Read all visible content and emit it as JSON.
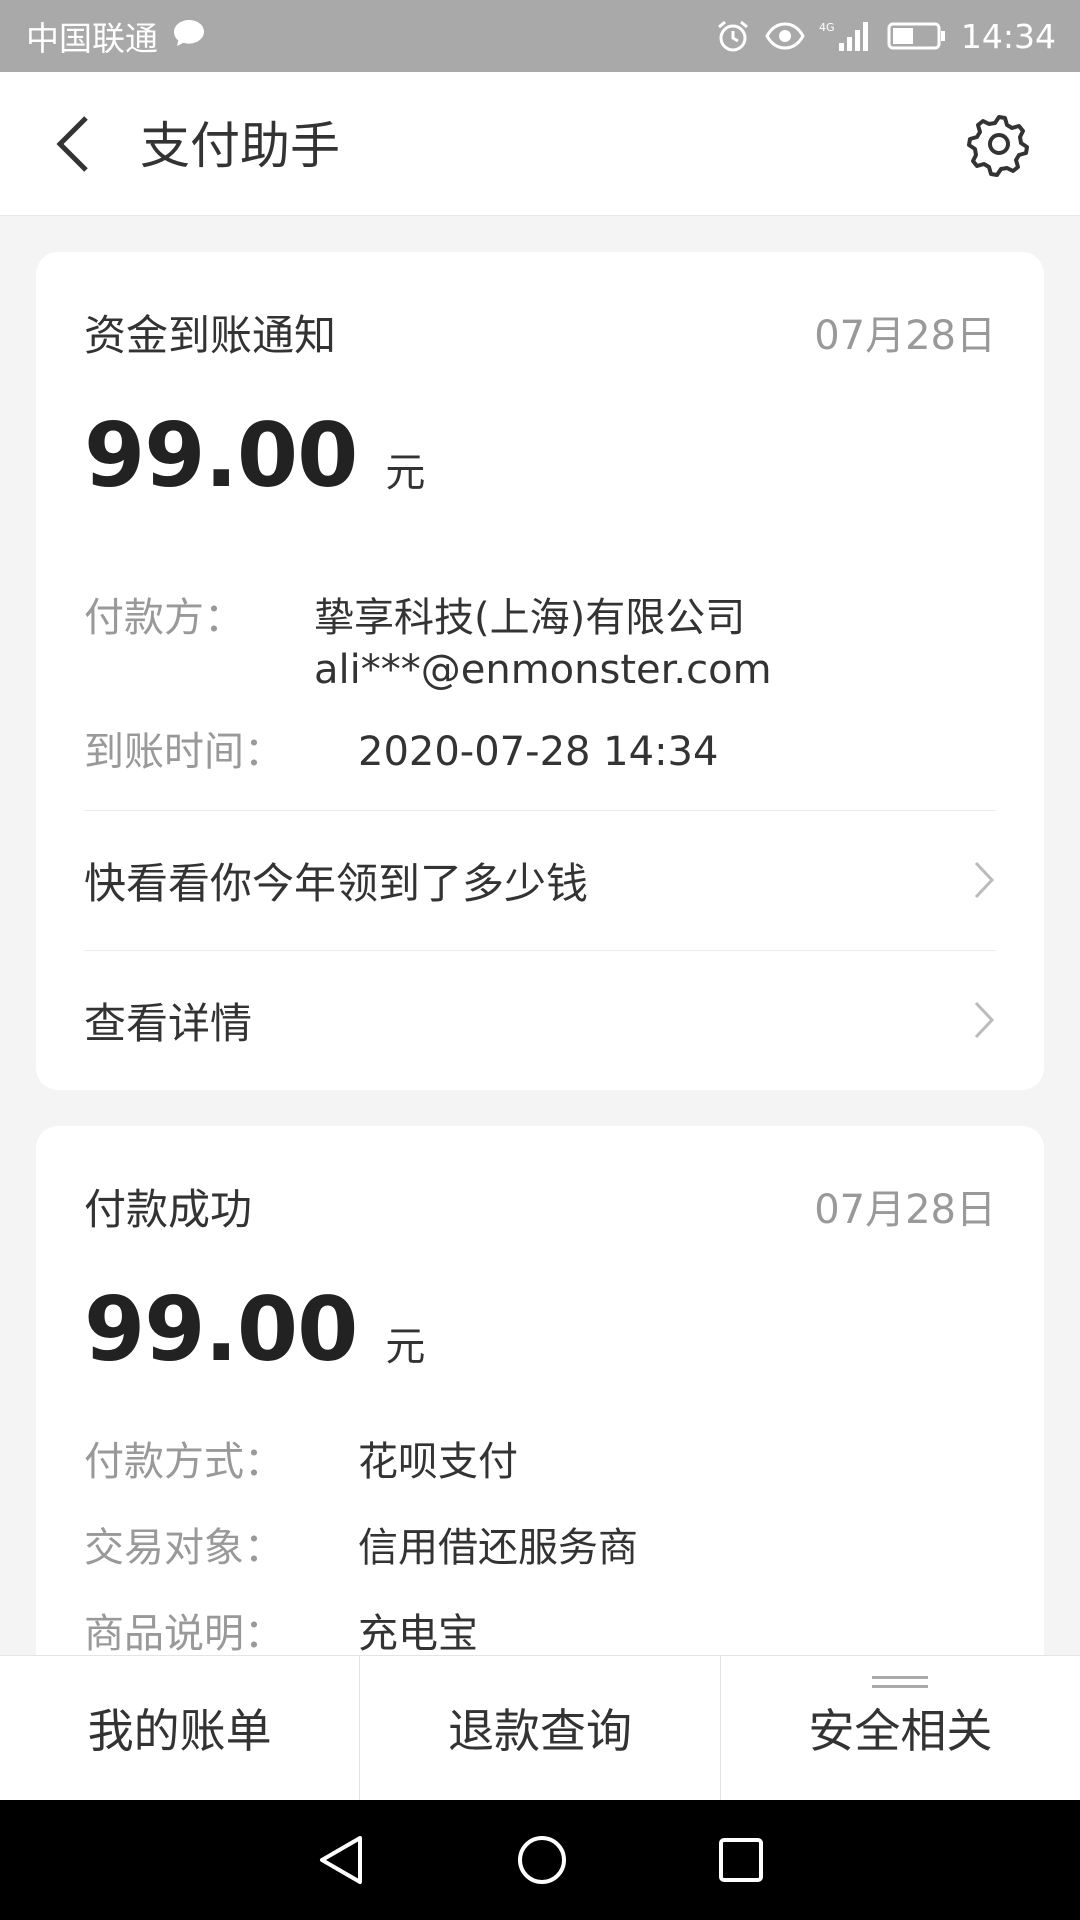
{
  "status_bar": {
    "carrier": "中国联通",
    "network": "4G",
    "time": "14:34"
  },
  "header": {
    "title": "支付助手",
    "back_icon": "chevron-left-icon",
    "settings_icon": "gear-icon"
  },
  "cards": [
    {
      "title": "资金到账通知",
      "date": "07月28日",
      "amount": "99.00",
      "unit": "元",
      "rows": [
        {
          "label": "付款方：",
          "value_line1": "挚享科技(上海)有限公司",
          "value_line2": "ali***@enmonster.com"
        },
        {
          "label": "到账时间：",
          "value": "2020-07-28 14:34"
        }
      ],
      "links": [
        {
          "label": "快看看你今年领到了多少钱"
        },
        {
          "label": "查看详情"
        }
      ]
    },
    {
      "title": "付款成功",
      "date": "07月28日",
      "amount": "99.00",
      "unit": "元",
      "rows": [
        {
          "label": "付款方式：",
          "value": "花呗支付"
        },
        {
          "label": "交易对象：",
          "value": "信用借还服务商"
        },
        {
          "label": "商品说明：",
          "value": "充电宝"
        }
      ]
    }
  ],
  "tab_bar": {
    "tabs": [
      {
        "label": "我的账单"
      },
      {
        "label": "退款查询"
      },
      {
        "label": "安全相关"
      }
    ]
  },
  "colors": {
    "status_bar_bg": "#a9a9a9",
    "page_bg": "#f4f4f4",
    "muted_text": "#999999"
  }
}
